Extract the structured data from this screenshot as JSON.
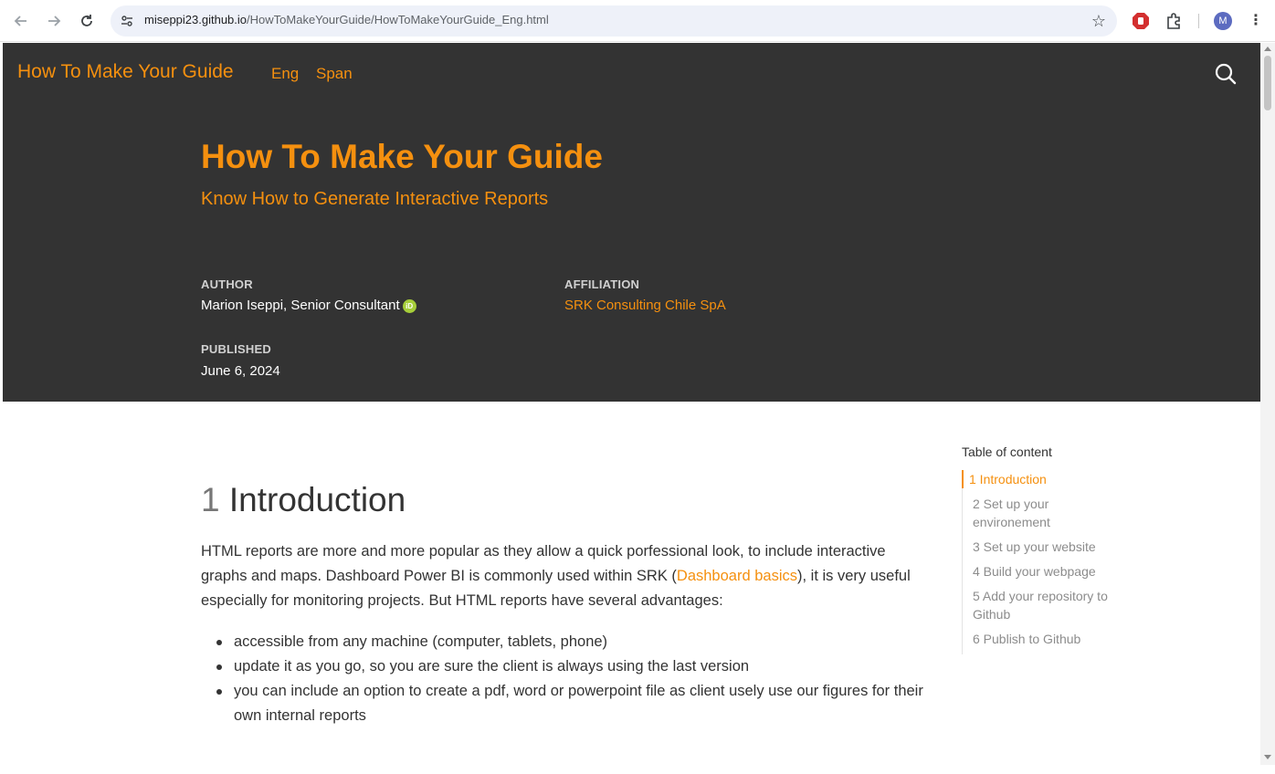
{
  "browser": {
    "url_host": "miseppi23.github.io",
    "url_path": "/HowToMakeYourGuide/HowToMakeYourGuide_Eng.html",
    "profile_initial": "M"
  },
  "navbar": {
    "brand": "How To Make Your Guide",
    "links": [
      "Eng",
      "Span"
    ]
  },
  "hero": {
    "title": "How To Make Your Guide",
    "subtitle": "Know How to Generate Interactive Reports",
    "author_label": "AUTHOR",
    "author_value": "Marion Iseppi, Senior Consultant",
    "affiliation_label": "AFFILIATION",
    "affiliation_value": "SRK Consulting Chile SpA",
    "published_label": "PUBLISHED",
    "published_value": "June 6, 2024"
  },
  "content": {
    "section_number": "1",
    "section_title": "Introduction",
    "para_part1": "HTML reports are more and more popular as they allow a quick porfessional look, to include interactive graphs and maps. Dashboard Power BI is commonly used within SRK (",
    "para_link": "Dashboard basics",
    "para_part2": "), it is very useful especially for monitoring projects. But HTML reports have several advantages:",
    "bullets": [
      "accessible from any machine (computer, tablets, phone)",
      "update it as you go, so you are sure the client is always using the last version",
      "you can include an option to create a pdf, word or powerpoint file as client usely use our figures for their own internal reports"
    ]
  },
  "toc": {
    "title": "Table of content",
    "items": [
      "1 Introduction",
      "2 Set up your environement",
      "3 Set up your website",
      "4 Build your webpage",
      "5 Add your repository to Github",
      "6 Publish to Github"
    ]
  },
  "colors": {
    "accent": "#f5900f",
    "hero_bg": "#333333"
  }
}
